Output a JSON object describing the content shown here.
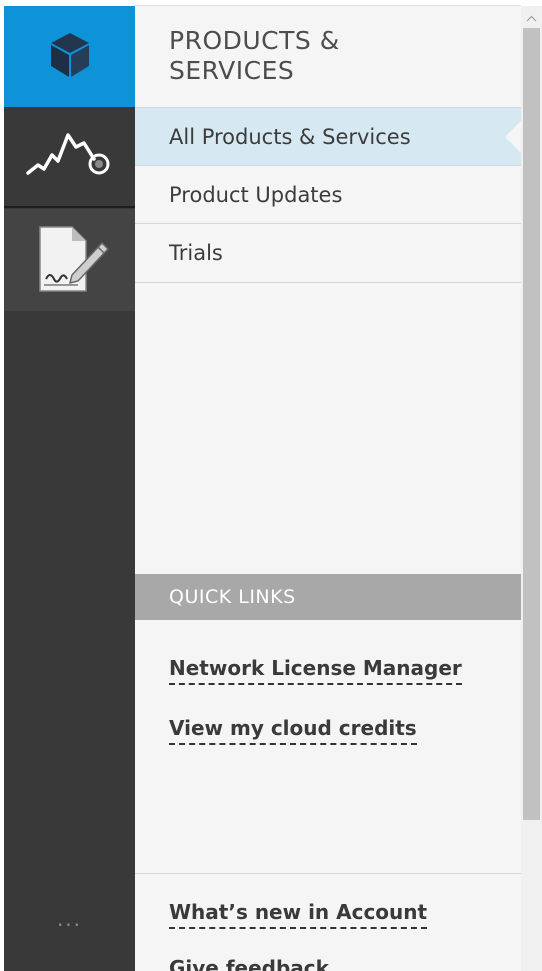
{
  "panel": {
    "title_line1": "PRODUCTS &",
    "title_line2": "SERVICES"
  },
  "nav": {
    "items": [
      {
        "label": "All Products & Services",
        "active": true
      },
      {
        "label": "Product Updates",
        "active": false
      },
      {
        "label": "Trials",
        "active": false
      }
    ]
  },
  "rail": {
    "items": [
      {
        "icon": "cube-icon",
        "active": true
      },
      {
        "icon": "usage-graph-icon",
        "active": false
      },
      {
        "icon": "contract-signature-icon",
        "active": false
      }
    ],
    "more_label": "..."
  },
  "quick_links": {
    "header": "QUICK LINKS",
    "links": [
      {
        "label": "Network License Manager"
      },
      {
        "label": "View my cloud credits"
      }
    ]
  },
  "footer": {
    "links": [
      {
        "label": "What’s new in Account"
      },
      {
        "label": "Give feedback"
      }
    ]
  },
  "colors": {
    "rail_background": "#393939",
    "active_rail_item": "#0e92d8",
    "active_nav_item": "#d6e9f2",
    "panel_background": "#f5f5f5",
    "quick_links_header": "#a8a8a8"
  }
}
